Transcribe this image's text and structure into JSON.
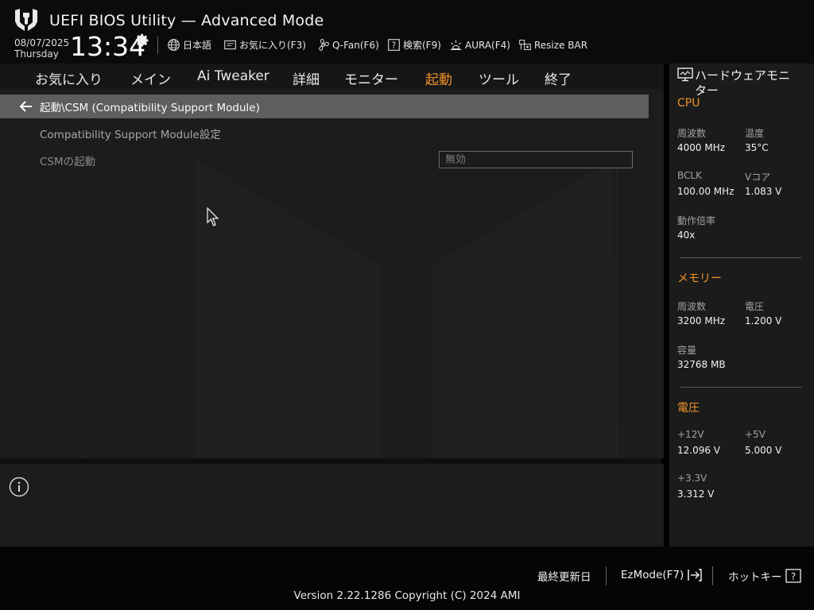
{
  "header": {
    "title": "UEFI BIOS Utility — Advanced Mode",
    "date": "08/07/2025",
    "weekday": "Thursday",
    "time": "13:34"
  },
  "toolbar": {
    "language": "日本語",
    "favorites": "お気に入り(F3)",
    "qfan": "Q-Fan(F6)",
    "search": "検索(F9)",
    "aura": "AURA(F4)",
    "resize_bar": "Resize BAR"
  },
  "tabs": [
    {
      "label": "お気に入り"
    },
    {
      "label": "メイン"
    },
    {
      "label": "Ai Tweaker"
    },
    {
      "label": "詳細"
    },
    {
      "label": "モニター"
    },
    {
      "label": "起動"
    },
    {
      "label": "ツール"
    },
    {
      "label": "終了"
    }
  ],
  "active_tab": "起動",
  "breadcrumb": "起動\\CSM (Compatibility Support Module)",
  "section_header": "Compatibility Support Module設定",
  "setting": {
    "label": "CSMの起動",
    "value": "無効"
  },
  "hw_monitor": {
    "title_line1": "ハードウェアモニ",
    "title_line2": "ター",
    "cpu": {
      "title": "CPU",
      "freq_label": "周波数",
      "freq_value": "4000 MHz",
      "temp_label": "温度",
      "temp_value": "35°C",
      "bclk_label": "BCLK",
      "bclk_value": "100.00 MHz",
      "vcore_label": "Vコア",
      "vcore_value": "1.083 V",
      "ratio_label": "動作倍率",
      "ratio_value": "40x"
    },
    "memory": {
      "title": "メモリー",
      "freq_label": "周波数",
      "freq_value": "3200 MHz",
      "volt_label": "電圧",
      "volt_value": "1.200 V",
      "cap_label": "容量",
      "cap_value": "32768 MB"
    },
    "voltage": {
      "title": "電圧",
      "v12_label": "+12V",
      "v12_value": "12.096 V",
      "v5_label": "+5V",
      "v5_value": "5.000 V",
      "v33_label": "+3.3V",
      "v33_value": "3.312 V"
    }
  },
  "footer": {
    "last_modified": "最終更新日",
    "ezmode": "EzMode(F7)",
    "hotkeys": "ホットキー",
    "version": "Version 2.22.1286 Copyright (C) 2024 AMI"
  },
  "colors": {
    "accent": "#f0922b",
    "background": "#1c1c1c",
    "breadcrumb_bar": "#5e5e5e"
  }
}
